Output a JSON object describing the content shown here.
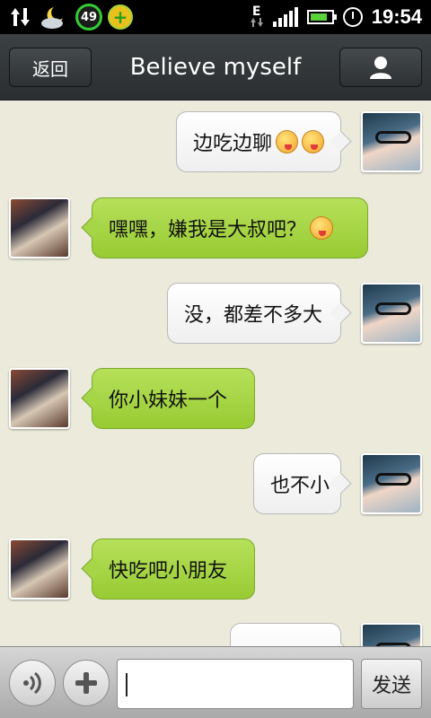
{
  "status_bar": {
    "battery_badge": "49",
    "network_type": "E",
    "time": "19:54"
  },
  "header": {
    "back_label": "返回",
    "title": "Believe myself",
    "profile_icon": "person-icon"
  },
  "messages": [
    {
      "sender": "self",
      "text": "边吃边聊",
      "emoji_count": 2
    },
    {
      "sender": "friend",
      "text": "嘿嘿，嫌我是大叔吧？",
      "emoji_count": 1
    },
    {
      "sender": "self",
      "text": "没，都差不多大",
      "emoji_count": 0
    },
    {
      "sender": "friend",
      "text": "你小妹妹一个",
      "emoji_count": 0
    },
    {
      "sender": "self",
      "text": "也不小",
      "emoji_count": 0
    },
    {
      "sender": "friend",
      "text": "快吃吧小朋友",
      "emoji_count": 0
    }
  ],
  "input_bar": {
    "voice_icon": "voice-icon",
    "plus_icon": "plus-icon",
    "input_value": "",
    "send_label": "发送"
  },
  "colors": {
    "chat_background": "#eceadb",
    "friend_bubble": "#a7d548",
    "self_bubble": "#ffffff",
    "titlebar": "#32373a"
  }
}
